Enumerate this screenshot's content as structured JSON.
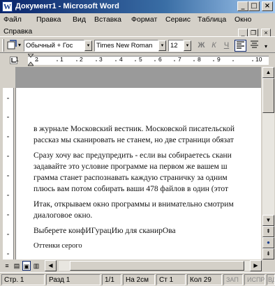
{
  "window": {
    "title": "Документ1 - Microsoft Word",
    "app_icon": "word-icon",
    "controls": {
      "minimize": "_",
      "maximize": "□",
      "close": "×"
    }
  },
  "menu": {
    "items": [
      "Файл",
      "Правка",
      "Вид",
      "Вставка",
      "Формат",
      "Сервис",
      "Таблица",
      "Окно"
    ],
    "second_row": "Справка",
    "doc_controls": {
      "minimize": "_",
      "restore": "❐",
      "close": "×"
    }
  },
  "toolbar": {
    "style_value": "Обычный + Гос",
    "font_value": "Times New Roman",
    "size_value": "12",
    "bold": "Ж",
    "italic": "К",
    "underline": "Ч",
    "dropdown_glyph": "▾",
    "menu_glyph": "▾"
  },
  "ruler": {
    "numbers": [
      "1",
      "2",
      "1",
      "2",
      "3",
      "4",
      "5",
      "6",
      "7",
      "8",
      "9",
      "10"
    ]
  },
  "document": {
    "lines": [
      "в журнале Московский вестник. Московской писательской",
      "рассказ мы сканировать не станем, но две страници обязат",
      "Сразу хочу вас предупредить - если вы собираетесь скани",
      "задавайте это условие программе на первом же вашем ш",
      "грамма станет распознавать каждую страничку за одним",
      "плюсь вам потом собирать ваши 478 файлов в один (этот",
      "Итак, открываем окно программы и внимательно смотрим",
      "диалоговое окно.",
      "Выберете конфИГурацИю для сканирОва",
      "Оттенки серого"
    ]
  },
  "scroll": {
    "up": "▲",
    "down": "▼",
    "prev_page": "⇞",
    "browse": "●",
    "next_page": "⇟",
    "left": "◀",
    "right": "▶"
  },
  "views": [
    "≡",
    "▤",
    "▣",
    "▥"
  ],
  "status": {
    "page": "Стр. 1",
    "section": "Разд 1",
    "pages": "1/1",
    "at": "На 2см",
    "line": "Ст 1",
    "col": "Кол 29",
    "rec": "ЗАП",
    "trk": "ИСПР",
    "ext": "ВДЛ"
  }
}
